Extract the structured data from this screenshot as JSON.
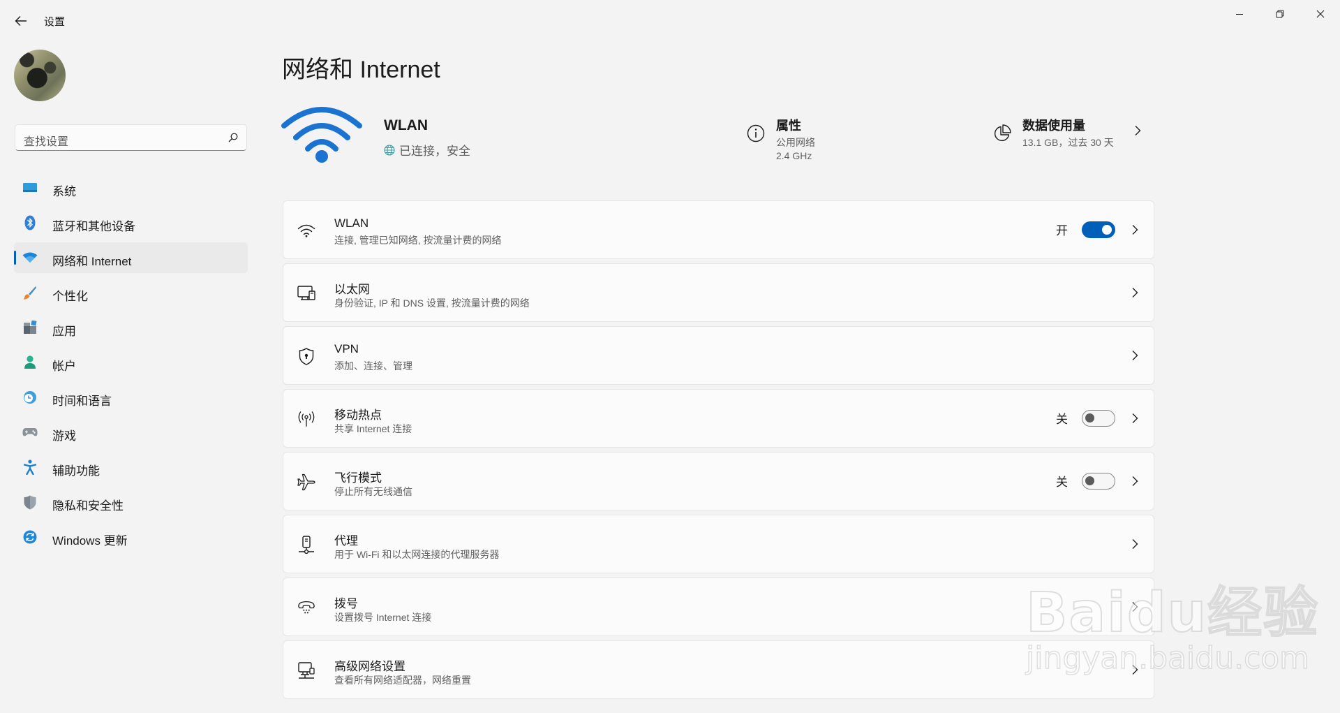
{
  "window": {
    "title": "设置"
  },
  "search": {
    "placeholder": "查找设置"
  },
  "sidebar": {
    "items": [
      {
        "label": "系统",
        "icon": "monitor-icon",
        "active": false
      },
      {
        "label": "蓝牙和其他设备",
        "icon": "bluetooth-icon",
        "active": false
      },
      {
        "label": "网络和 Internet",
        "icon": "wifi-icon",
        "active": true
      },
      {
        "label": "个性化",
        "icon": "brush-icon",
        "active": false
      },
      {
        "label": "应用",
        "icon": "apps-icon",
        "active": false
      },
      {
        "label": "帐户",
        "icon": "person-icon",
        "active": false
      },
      {
        "label": "时间和语言",
        "icon": "clock-globe-icon",
        "active": false
      },
      {
        "label": "游戏",
        "icon": "gamepad-icon",
        "active": false
      },
      {
        "label": "辅助功能",
        "icon": "accessibility-icon",
        "active": false
      },
      {
        "label": "隐私和安全性",
        "icon": "shield-icon",
        "active": false
      },
      {
        "label": "Windows 更新",
        "icon": "sync-icon",
        "active": false
      }
    ]
  },
  "main": {
    "title": "网络和 Internet",
    "hero": {
      "name": "WLAN",
      "status": "已连接，安全"
    },
    "properties": {
      "title": "属性",
      "line1": "公用网络",
      "line2": "2.4 GHz"
    },
    "data_usage": {
      "title": "数据使用量",
      "detail": "13.1 GB，过去 30 天"
    },
    "cards": [
      {
        "title": "WLAN",
        "subtitle": "连接, 管理已知网络, 按流量计费的网络",
        "icon": "wifi-icon",
        "toggle_label": "开",
        "toggle_on": true
      },
      {
        "title": "以太网",
        "subtitle": "身份验证, IP 和 DNS 设置, 按流量计费的网络",
        "icon": "ethernet-icon"
      },
      {
        "title": "VPN",
        "subtitle": "添加、连接、管理",
        "icon": "vpn-shield-icon"
      },
      {
        "title": "移动热点",
        "subtitle": "共享 Internet 连接",
        "icon": "hotspot-icon",
        "toggle_label": "关",
        "toggle_on": false
      },
      {
        "title": "飞行模式",
        "subtitle": "停止所有无线通信",
        "icon": "airplane-icon",
        "toggle_label": "关",
        "toggle_on": false
      },
      {
        "title": "代理",
        "subtitle": "用于 Wi-Fi 和以太网连接的代理服务器",
        "icon": "proxy-icon"
      },
      {
        "title": "拨号",
        "subtitle": "设置拨号 Internet 连接",
        "icon": "dialup-icon"
      },
      {
        "title": "高级网络设置",
        "subtitle": "查看所有网络适配器，网络重置",
        "icon": "advanced-network-icon"
      }
    ]
  },
  "watermark": {
    "logo": "Baidu经验",
    "url": "jingyan.baidu.com"
  },
  "colors": {
    "accent": "#005fb8",
    "wifi_hero": "#1a73d0",
    "background": "#f3f3f3",
    "card": "#fbfbfb"
  }
}
